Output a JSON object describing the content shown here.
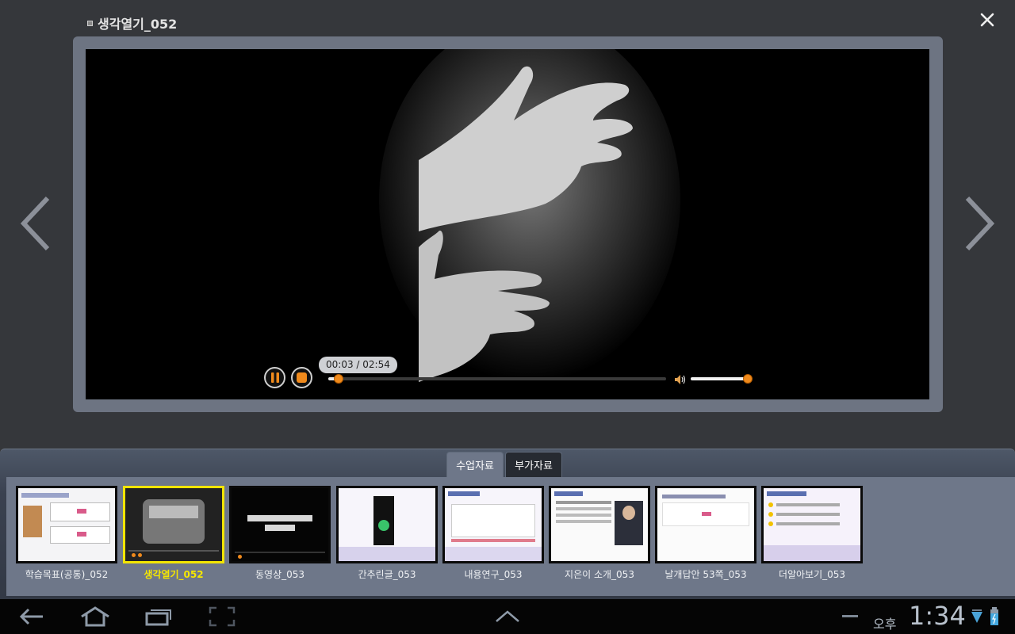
{
  "header": {
    "title": "생각열기_052"
  },
  "player": {
    "time": "00:03 / 02:54",
    "progress_percent": 3,
    "volume_percent": 100
  },
  "tabs": [
    {
      "label": "수업자료",
      "active": true
    },
    {
      "label": "부가자료",
      "active": false
    }
  ],
  "thumbnails": [
    {
      "label": "학습목표(공통)_052",
      "selected": false
    },
    {
      "label": "생각열기_052",
      "selected": true
    },
    {
      "label": "동영상_053",
      "selected": false
    },
    {
      "label": "간추린글_053",
      "selected": false
    },
    {
      "label": "내용연구_053",
      "selected": false
    },
    {
      "label": "지은이 소개_053",
      "selected": false
    },
    {
      "label": "날개답안 53쪽_053",
      "selected": false
    },
    {
      "label": "더알아보기_053",
      "selected": false
    }
  ],
  "status_bar": {
    "ampm": "오후",
    "time": "1:34"
  },
  "colors": {
    "accent_orange": "#f08a1c",
    "selected_yellow": "#f3e500",
    "panel": "#6e7789"
  },
  "icons": [
    "close-icon",
    "chevron-left-icon",
    "chevron-right-icon",
    "pause-icon",
    "stop-icon",
    "volume-icon",
    "back-icon",
    "home-icon",
    "recent-apps-icon",
    "screenshot-icon",
    "chevron-up-icon",
    "wifi-icon",
    "battery-icon"
  ]
}
